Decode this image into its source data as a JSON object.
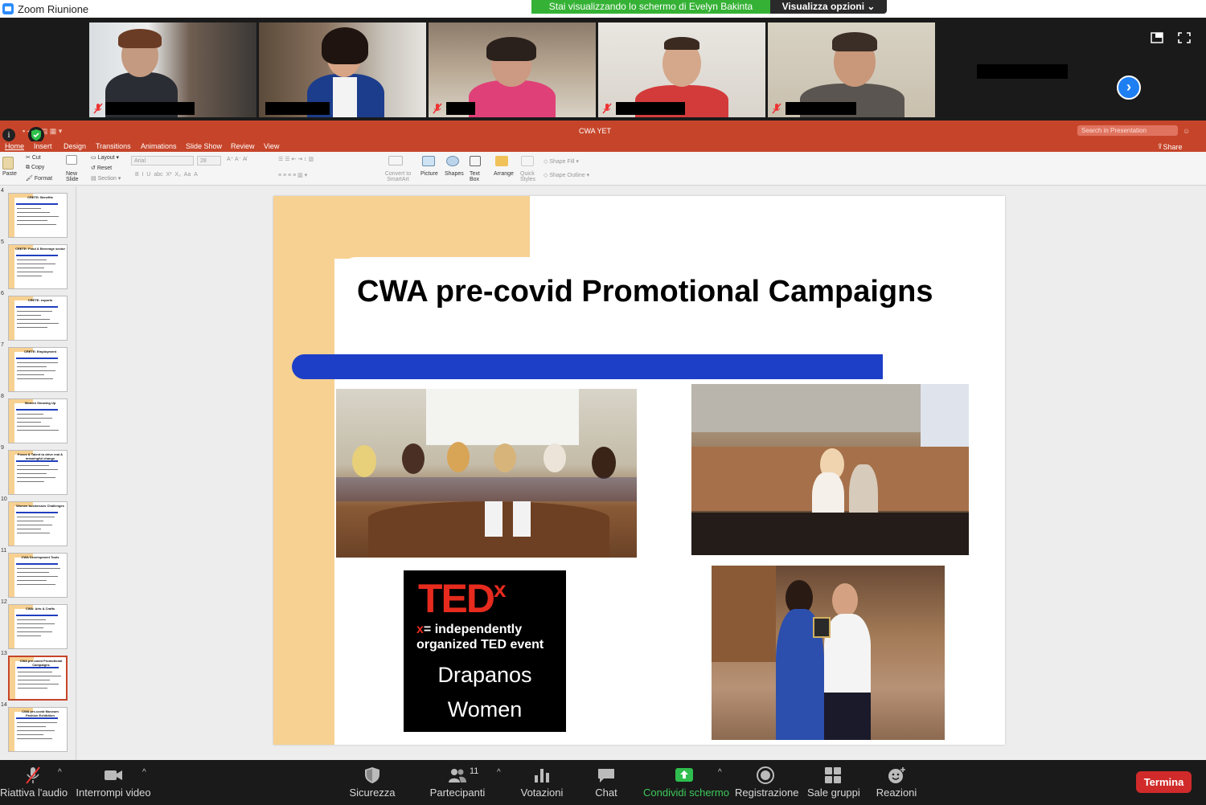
{
  "window": {
    "title": "Zoom Riunione"
  },
  "banner": {
    "sharing_text": "Stai visualizzando lo schermo di Evelyn Bakinta",
    "view_options_label": "Visualizza opzioni ⌄"
  },
  "video_strip": {
    "next_arrow": "›"
  },
  "powerpoint": {
    "doc_title": "CWA YET",
    "search_placeholder": "Search in Presentation",
    "tabs": [
      "Home",
      "Insert",
      "Design",
      "Transitions",
      "Animations",
      "Slide Show",
      "Review",
      "View"
    ],
    "share_label": "Share",
    "ribbon": {
      "paste": "Paste",
      "cut": "Cut",
      "copy": "Copy",
      "format": "Format",
      "new_slide": "New Slide",
      "layout": "Layout",
      "reset": "Reset",
      "section": "Section",
      "font_name": "Arial",
      "font_size": "28",
      "convert_smartart": "Convert to SmartArt",
      "picture": "Picture",
      "shapes": "Shapes",
      "text_box": "Text Box",
      "arrange": "Arrange",
      "quick_styles": "Quick Styles",
      "shape_fill": "Shape Fill",
      "shape_outline": "Shape Outline"
    },
    "thumbnails": [
      {
        "num": "4",
        "title": "CRETE: Benefits"
      },
      {
        "num": "5",
        "title": "CRETE: Food & Beverage sector"
      },
      {
        "num": "6",
        "title": "CRETE: exports"
      },
      {
        "num": "7",
        "title": "CRETE: Employment"
      },
      {
        "num": "8",
        "title": "Women Showing Up"
      },
      {
        "num": "9",
        "title": "Focus & Talent to drive real & meaningful change"
      },
      {
        "num": "10",
        "title": "Women businesses Challenges"
      },
      {
        "num": "11",
        "title": "CWA Development Tools"
      },
      {
        "num": "12",
        "title": "CWA: Arts & Crafts"
      },
      {
        "num": "13",
        "title": "CWA pre-covid Promotional Campaigns"
      },
      {
        "num": "14",
        "title": "CWA pre-covid Museum Fashion Exhibition"
      }
    ],
    "slide": {
      "title": "CWA pre-covid Promotional Campaigns",
      "tedx": {
        "brand": "TED",
        "x": "x",
        "tag_x": "x",
        "tagline": "= independently organized TED event",
        "line1": "Drapanos",
        "line2": "Women"
      }
    }
  },
  "toolbar": {
    "audio": "Riattiva l'audio",
    "video": "Interrompi video",
    "security": "Sicurezza",
    "participants": "Partecipanti",
    "participants_count": "11",
    "polls": "Votazioni",
    "chat": "Chat",
    "share": "Condividi schermo",
    "record": "Registrazione",
    "breakout": "Sale gruppi",
    "reactions": "Reazioni",
    "end": "Termina"
  },
  "colors": {
    "ppt_accent": "#c6452a",
    "share_green": "#35b235",
    "zoom_blue": "#1e7ff3",
    "end_red": "#d12a2a",
    "slide_yellow": "#f7d192",
    "slide_blue": "#1d3fc7"
  }
}
